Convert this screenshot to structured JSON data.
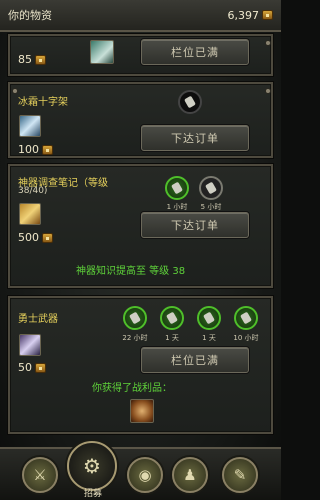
{
  "header": {
    "title": "你的物资",
    "gold": "6,397"
  },
  "missions": [
    {
      "cost": "85",
      "button": "栏位已满"
    },
    {
      "name": "冰霜十字架",
      "cost": "100",
      "button": "下达订单"
    },
    {
      "name": "神器调查笔记（等级",
      "progress_text": "38/40)",
      "cost": "500",
      "button": "下达订单",
      "timers": [
        "1 小时",
        "5 小时"
      ],
      "note": "神器知识提高至  等级 38"
    },
    {
      "name": "勇士武器",
      "cost": "50",
      "button": "栏位已满",
      "timers": [
        "22 小时",
        "1 天",
        "1 天",
        "10 小时"
      ],
      "note": "你获得了战利品："
    }
  ],
  "nav": {
    "recruit_label": "招募"
  },
  "colors": {
    "accent_gold": "#e6d15c",
    "accent_green": "#5fd33a",
    "panel_border": "#4e4a3e"
  }
}
